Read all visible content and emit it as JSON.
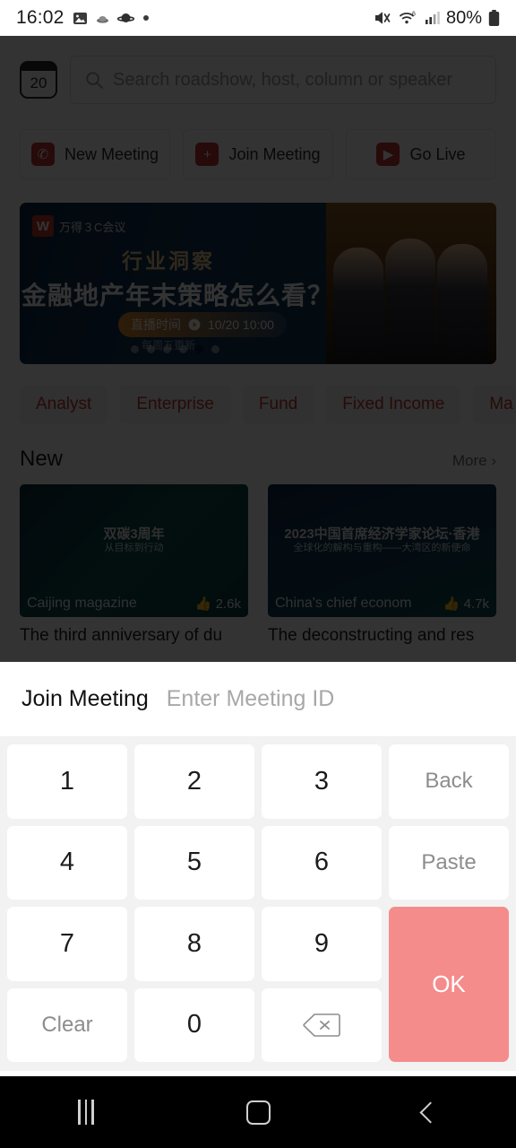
{
  "status_bar": {
    "time": "16:02",
    "left_icons": [
      "image-icon",
      "cloud-icon",
      "saturn-icon",
      "dot-icon"
    ],
    "right_icons": [
      "mute-icon",
      "wifi-6-icon",
      "cellular-signal-icon"
    ],
    "battery_percent": "80%"
  },
  "app": {
    "calendar_icon_day": "20",
    "search": {
      "placeholder": "Search roadshow, host, column or speaker",
      "value": ""
    },
    "actions": [
      {
        "label": "New Meeting",
        "icon": "phone-call-icon",
        "glyph": "✆"
      },
      {
        "label": "Join Meeting",
        "icon": "plus-icon",
        "glyph": "+"
      },
      {
        "label": "Go Live",
        "icon": "play-icon",
        "glyph": "▶"
      }
    ],
    "banner": {
      "brand_mark": "W",
      "brand_name": "万得３C会议",
      "subtitle": "行业洞察",
      "title": "金融地产年末策略怎么看？",
      "time_label": "直播时间",
      "time_value": "10/20 10:00",
      "note": "每周五更新",
      "dot_count": 6,
      "active_dot": 5
    },
    "chips": [
      "Analyst",
      "Enterprise",
      "Fund",
      "Fixed Income",
      "Ma"
    ],
    "section": {
      "title": "New",
      "more_label": "More",
      "more_chevron": "›"
    },
    "cards": [
      {
        "thumb_title": "双碳3周年",
        "thumb_title2": "从目标到行动",
        "source": "Caijing magazine",
        "likes": "2.6k",
        "like_icon": "thumbs-up-icon",
        "caption": "The third anniversary of du"
      },
      {
        "thumb_title": "2023中国首席经济学家论坛·香港",
        "thumb_title2": "全球化的解构与重构——大湾区的新使命",
        "source": "China's chief econom",
        "likes": "4.7k",
        "like_icon": "thumbs-up-icon",
        "caption": "The deconstructing and res"
      }
    ]
  },
  "join_meeting_sheet": {
    "title": "Join Meeting",
    "input_placeholder": "Enter Meeting ID",
    "input_value": "",
    "keys": [
      {
        "label": "1",
        "name": "key-1",
        "type": "digit"
      },
      {
        "label": "2",
        "name": "key-2",
        "type": "digit"
      },
      {
        "label": "3",
        "name": "key-3",
        "type": "digit"
      },
      {
        "label": "Back",
        "name": "key-back",
        "type": "word"
      },
      {
        "label": "4",
        "name": "key-4",
        "type": "digit"
      },
      {
        "label": "5",
        "name": "key-5",
        "type": "digit"
      },
      {
        "label": "6",
        "name": "key-6",
        "type": "digit"
      },
      {
        "label": "Paste",
        "name": "key-paste",
        "type": "word"
      },
      {
        "label": "7",
        "name": "key-7",
        "type": "digit"
      },
      {
        "label": "8",
        "name": "key-8",
        "type": "digit"
      },
      {
        "label": "9",
        "name": "key-9",
        "type": "digit"
      },
      {
        "label": "OK",
        "name": "key-ok",
        "type": "ok"
      },
      {
        "label": "Clear",
        "name": "key-clear",
        "type": "word"
      },
      {
        "label": "0",
        "name": "key-0",
        "type": "digit"
      },
      {
        "label": "",
        "name": "key-backspace",
        "type": "backspace"
      }
    ]
  },
  "nav_bar": {
    "items": [
      {
        "name": "recents-button",
        "icon": "recents-icon"
      },
      {
        "name": "home-button",
        "icon": "home-icon"
      },
      {
        "name": "back-button",
        "icon": "back-chevron-icon"
      }
    ]
  },
  "colors": {
    "accent_red": "#c0392b",
    "ok_button": "#f48c8c",
    "keypad_bg": "#f2f2f2",
    "scrim": "rgba(0,0,0,0.80)"
  }
}
